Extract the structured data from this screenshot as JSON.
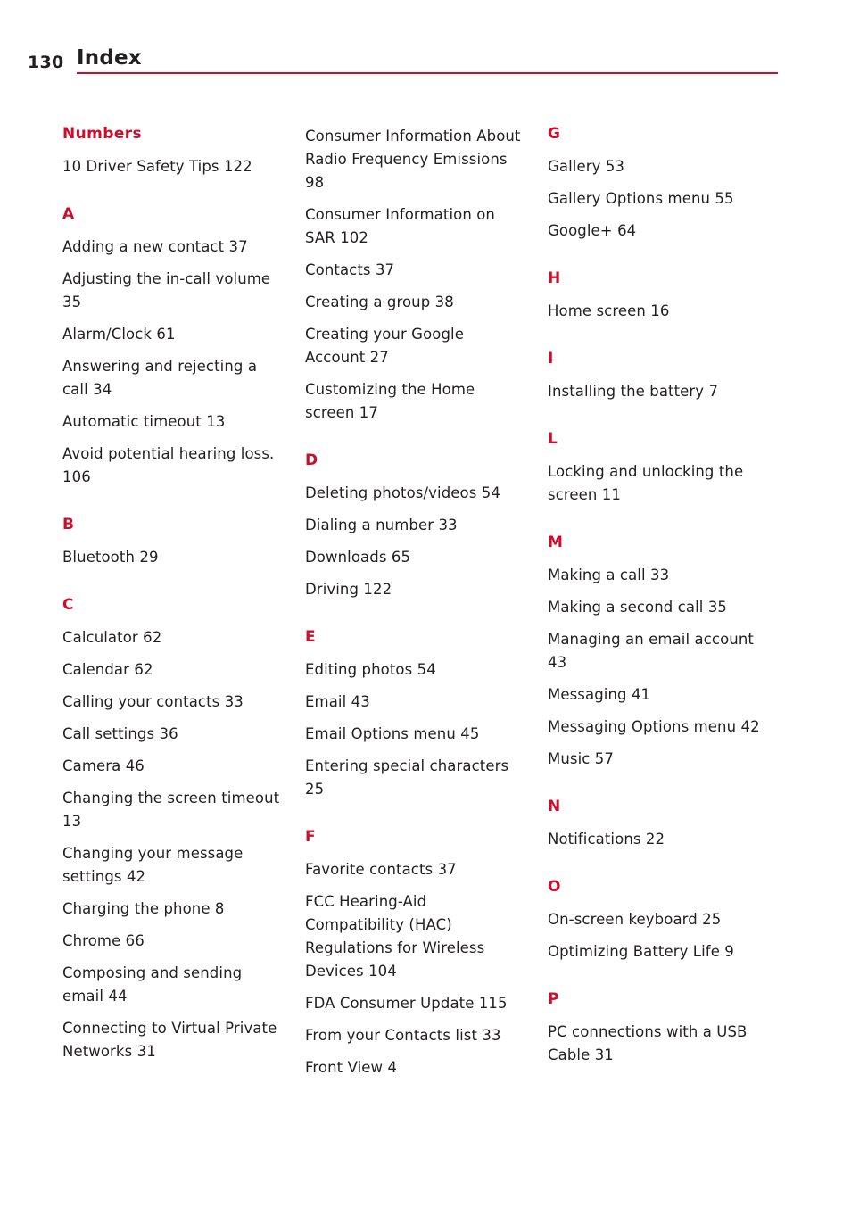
{
  "header": {
    "page_number": "130",
    "title": "Index",
    "rule_color": "#cc0e2d"
  },
  "columns": [
    {
      "sections": [
        {
          "letter": "Numbers",
          "entries": [
            {
              "text": "10 Driver Safety Tips",
              "page": "122"
            }
          ]
        },
        {
          "letter": "A",
          "entries": [
            {
              "text": "Adding a new contact",
              "page": "37"
            },
            {
              "text": "Adjusting the in-call volume",
              "page": "35"
            },
            {
              "text": "Alarm/Clock",
              "page": "61"
            },
            {
              "text": "Answering and rejecting a call",
              "page": "34"
            },
            {
              "text": "Automatic timeout",
              "page": "13"
            },
            {
              "text": "Avoid potential hearing loss.",
              "page": "106"
            }
          ]
        },
        {
          "letter": "B",
          "entries": [
            {
              "text": "Bluetooth",
              "page": "29"
            }
          ]
        },
        {
          "letter": "C",
          "entries": [
            {
              "text": "Calculator",
              "page": "62"
            },
            {
              "text": "Calendar",
              "page": "62"
            },
            {
              "text": "Calling your contacts",
              "page": "33"
            },
            {
              "text": "Call settings",
              "page": "36"
            },
            {
              "text": "Camera",
              "page": "46"
            },
            {
              "text": "Changing the screen timeout",
              "page": "13"
            },
            {
              "text": "Changing your message settings",
              "page": "42"
            },
            {
              "text": "Charging the phone",
              "page": "8"
            },
            {
              "text": "Chrome",
              "page": "66"
            },
            {
              "text": "Composing and sending email",
              "page": "44"
            },
            {
              "text": "Connecting to Virtual Private Networks",
              "page": "31"
            }
          ]
        }
      ]
    },
    {
      "sections": [
        {
          "letter": "",
          "entries": [
            {
              "text": "Consumer Information About Radio Frequency Emissions",
              "page": "98"
            },
            {
              "text": "Consumer Information on SAR",
              "page": "102"
            },
            {
              "text": "Contacts",
              "page": "37"
            },
            {
              "text": "Creating a group",
              "page": "38"
            },
            {
              "text": "Creating your Google Account",
              "page": "27"
            },
            {
              "text": "Customizing the Home screen",
              "page": "17"
            }
          ]
        },
        {
          "letter": "D",
          "entries": [
            {
              "text": "Deleting photos/videos",
              "page": "54"
            },
            {
              "text": "Dialing a number",
              "page": "33"
            },
            {
              "text": "Downloads",
              "page": "65"
            },
            {
              "text": "Driving",
              "page": "122"
            }
          ]
        },
        {
          "letter": "E",
          "entries": [
            {
              "text": "Editing photos",
              "page": "54"
            },
            {
              "text": "Email",
              "page": "43"
            },
            {
              "text": "Email Options menu",
              "page": "45"
            },
            {
              "text": "Entering special characters",
              "page": "25"
            }
          ]
        },
        {
          "letter": "F",
          "entries": [
            {
              "text": "Favorite contacts",
              "page": "37"
            },
            {
              "text": "FCC Hearing-Aid Compatibility (HAC) Regulations for Wireless Devices",
              "page": "104"
            },
            {
              "text": "FDA Consumer Update",
              "page": "115"
            },
            {
              "text": "From your Contacts list",
              "page": "33"
            },
            {
              "text": "Front View",
              "page": "4"
            }
          ]
        }
      ]
    },
    {
      "sections": [
        {
          "letter": "G",
          "entries": [
            {
              "text": "Gallery",
              "page": "53"
            },
            {
              "text": "Gallery Options menu",
              "page": "55"
            },
            {
              "text": "Google+",
              "page": "64"
            }
          ]
        },
        {
          "letter": "H",
          "entries": [
            {
              "text": "Home screen",
              "page": "16"
            }
          ]
        },
        {
          "letter": "I",
          "entries": [
            {
              "text": "Installing the battery",
              "page": "7"
            }
          ]
        },
        {
          "letter": "L",
          "entries": [
            {
              "text": "Locking and unlocking the screen",
              "page": "11"
            }
          ]
        },
        {
          "letter": "M",
          "entries": [
            {
              "text": "Making a call",
              "page": "33"
            },
            {
              "text": "Making a second call",
              "page": "35"
            },
            {
              "text": "Managing an email account",
              "page": "43"
            },
            {
              "text": "Messaging",
              "page": "41"
            },
            {
              "text": "Messaging Options menu",
              "page": "42"
            },
            {
              "text": "Music",
              "page": "57"
            }
          ]
        },
        {
          "letter": "N",
          "entries": [
            {
              "text": "Notifications",
              "page": "22"
            }
          ]
        },
        {
          "letter": "O",
          "entries": [
            {
              "text": "On-screen keyboard",
              "page": "25"
            },
            {
              "text": "Optimizing Battery Life",
              "page": "9"
            }
          ]
        },
        {
          "letter": "P",
          "entries": [
            {
              "text": "PC connections with a USB Cable",
              "page": "31"
            }
          ]
        }
      ]
    }
  ]
}
